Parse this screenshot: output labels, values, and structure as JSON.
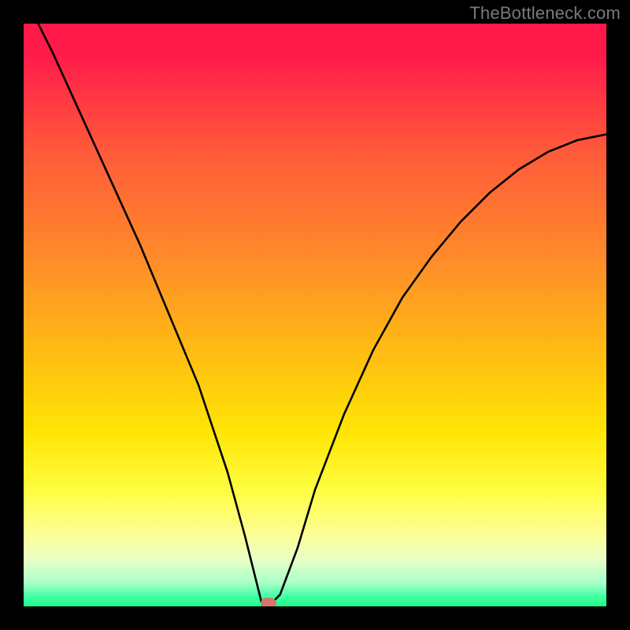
{
  "watermark": "TheBottleneck.com",
  "chart_data": {
    "type": "line",
    "title": "",
    "xlabel": "",
    "ylabel": "",
    "xlim": [
      0,
      1
    ],
    "ylim": [
      0,
      1
    ],
    "series": [
      {
        "name": "curve",
        "x": [
          0.0,
          0.025,
          0.05,
          0.1,
          0.15,
          0.2,
          0.25,
          0.3,
          0.35,
          0.38,
          0.4,
          0.41,
          0.42,
          0.44,
          0.47,
          0.5,
          0.55,
          0.6,
          0.65,
          0.7,
          0.75,
          0.8,
          0.85,
          0.9,
          0.95,
          1.0
        ],
        "values": [
          1.03,
          1.0,
          0.95,
          0.84,
          0.73,
          0.62,
          0.5,
          0.38,
          0.23,
          0.12,
          0.04,
          0.0,
          0.0,
          0.02,
          0.1,
          0.2,
          0.33,
          0.44,
          0.53,
          0.6,
          0.66,
          0.71,
          0.75,
          0.78,
          0.8,
          0.81
        ]
      }
    ],
    "marker": {
      "x": 0.42,
      "y": 0.0
    }
  }
}
